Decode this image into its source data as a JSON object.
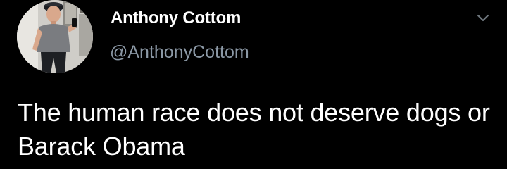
{
  "tweet": {
    "author": {
      "display_name": "Anthony Cottom",
      "handle": "@AnthonyCottom",
      "avatar_icon": "profile-photo"
    },
    "text": "The human race does not deserve dogs or Barack Obama",
    "menu_icon": "chevron-down-icon"
  },
  "colors": {
    "background": "#000000",
    "text_primary": "#ffffff",
    "text_secondary": "#8b98a5",
    "chevron": "#6e767d"
  }
}
